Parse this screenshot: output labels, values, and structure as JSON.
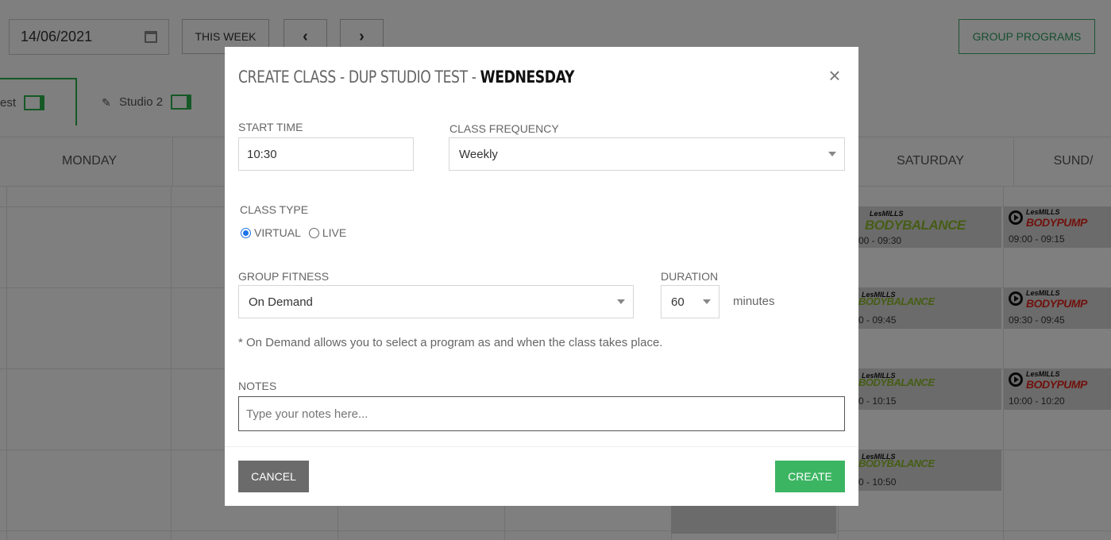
{
  "scheduler": {
    "date_value": "14/06/2021",
    "this_week_label": "THIS WEEK",
    "prev_label": "‹",
    "next_label": "›",
    "group_programs_label": "GROUP PROGRAMS",
    "tabs": [
      {
        "label": "est"
      },
      {
        "label": "Studio 2"
      }
    ],
    "days": {
      "monday": "MONDAY",
      "saturday": "SATURDAY",
      "sunday": "SUND/"
    },
    "cards": {
      "sat1": {
        "brand": "LesMILLS",
        "program": "BODYBALANCE",
        "time": "00 - 09:30"
      },
      "sat2": {
        "brand": "LesMILLS",
        "program": "BODYBALANCE",
        "time": "0 - 09:45"
      },
      "sat3": {
        "brand": "LesMILLS",
        "program": "BODYBALANCE",
        "time": "0 - 10:15"
      },
      "sat4": {
        "brand": "LesMILLS",
        "program": "BODYBALANCE",
        "time": "0 - 10:50"
      },
      "sun1": {
        "brand": "LesMILLS",
        "program": "BODYPUMP",
        "time": "09:00 - 09:15"
      },
      "sun2": {
        "brand": "LesMILLS",
        "program": "BODYPUMP",
        "time": "09:30 - 09:45"
      },
      "sun3": {
        "brand": "LesMILLS",
        "program": "BODYPUMP",
        "time": "10:00 - 10:20"
      }
    }
  },
  "modal": {
    "title_prefix": "CREATE CLASS - DUP STUDIO TEST - ",
    "title_day": "WEDNESDAY",
    "close_label": "×",
    "start_time_label": "START TIME",
    "start_time_value": "10:30",
    "frequency_label": "CLASS FREQUENCY",
    "frequency_value": "Weekly",
    "class_type_label": "CLASS TYPE",
    "class_type_options": [
      "VIRTUAL",
      "LIVE"
    ],
    "class_type_selected": "VIRTUAL",
    "group_fitness_label": "GROUP FITNESS",
    "group_fitness_value": "On Demand",
    "duration_label": "DURATION",
    "duration_value": "60",
    "duration_unit": "minutes",
    "hint": "* On Demand allows you to select a program as and when the class takes place.",
    "notes_label": "NOTES",
    "notes_placeholder": "Type your notes here...",
    "cancel_label": "CANCEL",
    "create_label": "CREATE"
  },
  "colors": {
    "accent_green": "#3cb562",
    "cancel_gray": "#6b6b6b",
    "radio_blue": "#1a73e8"
  }
}
